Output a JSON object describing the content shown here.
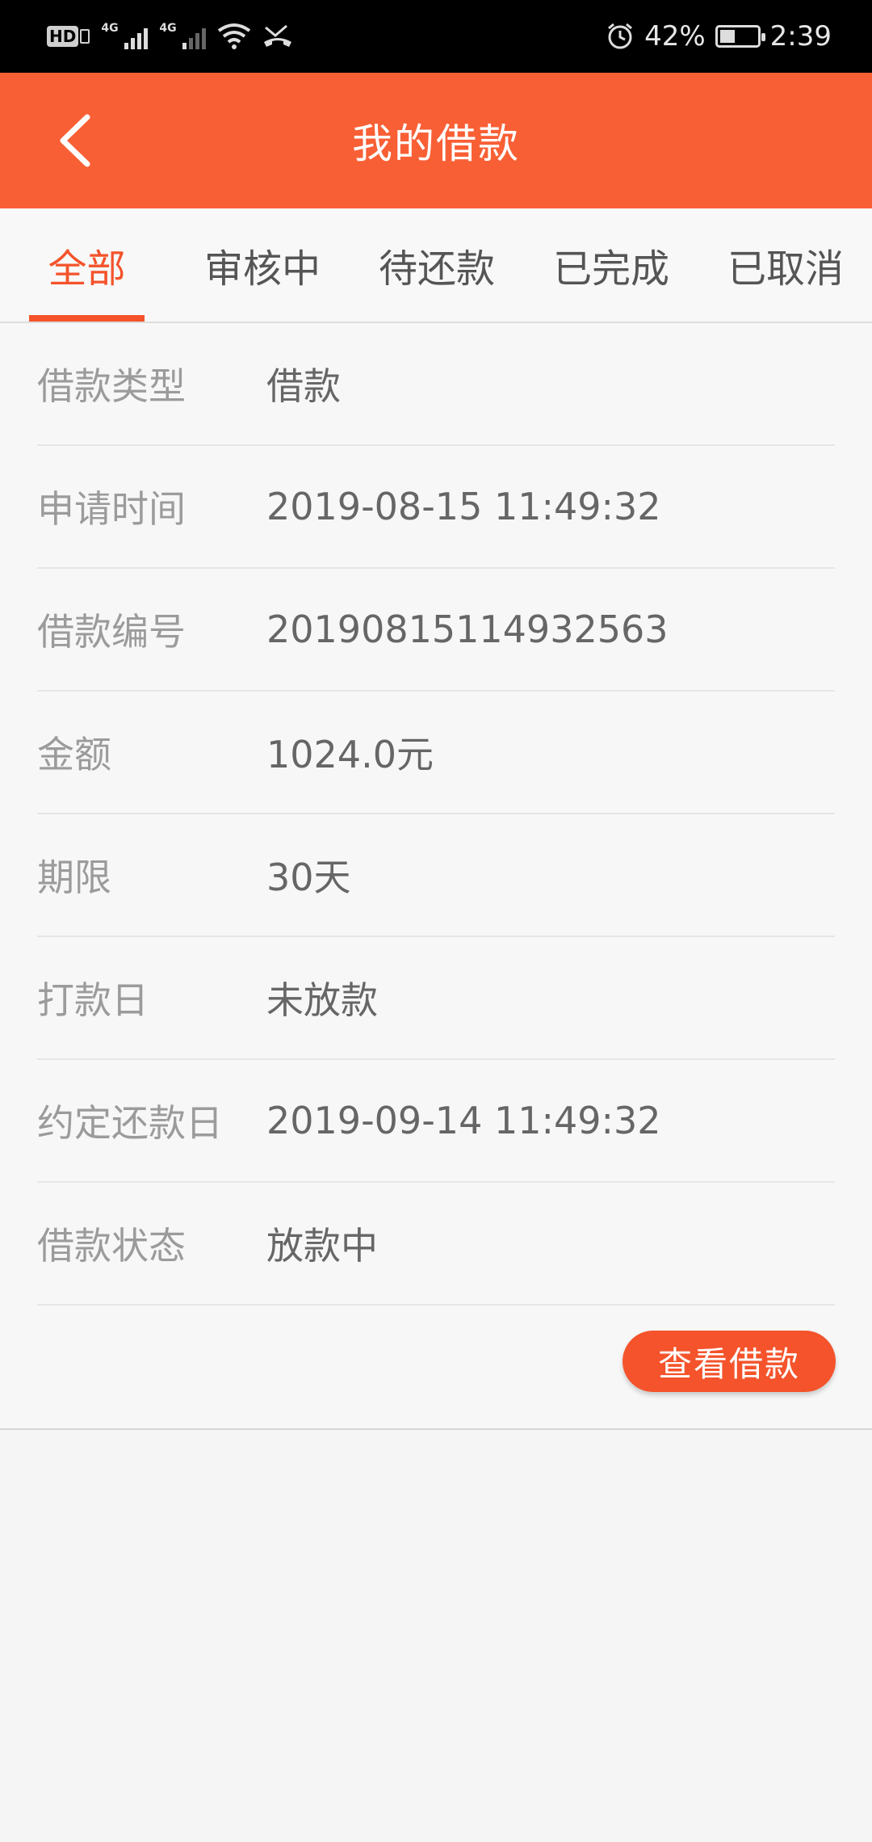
{
  "status_bar": {
    "hd": "HD",
    "net1": "4G",
    "net2": "4G",
    "battery_pct": "42%",
    "time": "2:39",
    "icons": [
      "hd-icon",
      "signal-icon",
      "wifi-icon",
      "missed-call-icon",
      "alarm-icon",
      "battery-icon"
    ]
  },
  "header": {
    "title": "我的借款",
    "back_icon": "chevron-left-icon",
    "color": "#f95f35"
  },
  "tabs": [
    {
      "label": "全部",
      "active": true
    },
    {
      "label": "审核中",
      "active": false
    },
    {
      "label": "待还款",
      "active": false
    },
    {
      "label": "已完成",
      "active": false
    },
    {
      "label": "已取消",
      "active": false
    }
  ],
  "loan": {
    "rows": [
      {
        "label": "借款类型",
        "value": "借款"
      },
      {
        "label": "申请时间",
        "value": "2019-08-15 11:49:32"
      },
      {
        "label": "借款编号",
        "value": "20190815114932563"
      },
      {
        "label": "金额",
        "value": "1024.0元"
      },
      {
        "label": "期限",
        "value": "30天"
      },
      {
        "label": "打款日",
        "value": "未放款"
      },
      {
        "label": "约定还款日",
        "value": "2019-09-14 11:49:32"
      },
      {
        "label": "借款状态",
        "value": "放款中"
      }
    ],
    "view_button": "查看借款"
  },
  "accent_color": "#f4532b"
}
